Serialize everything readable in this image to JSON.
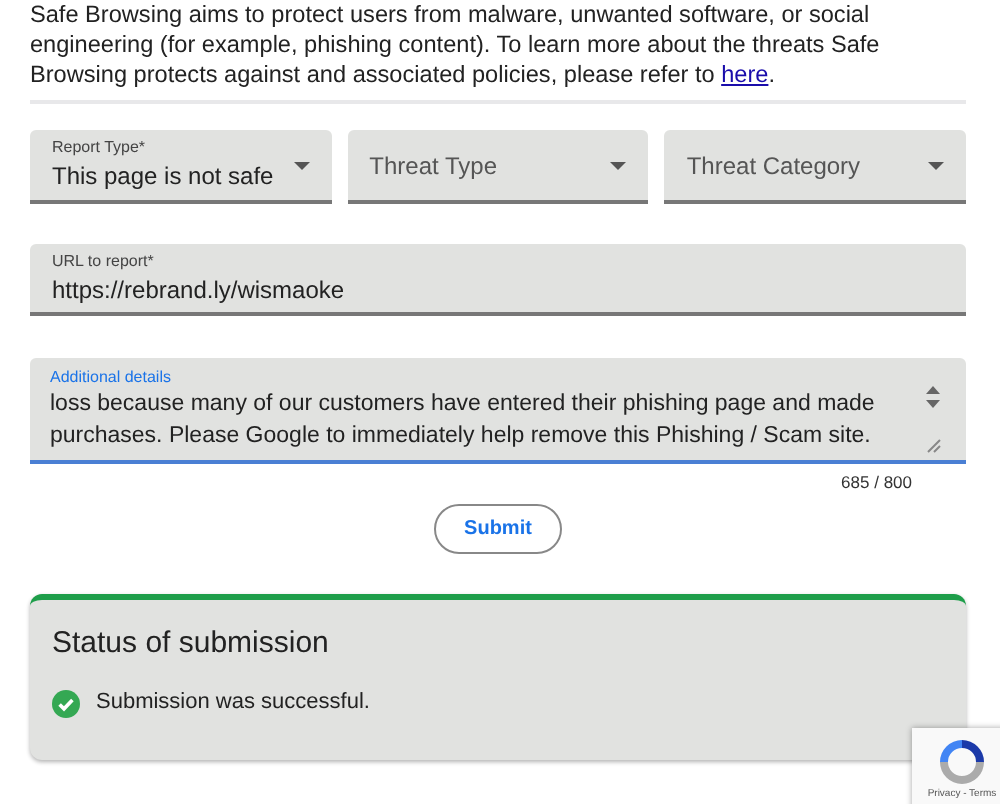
{
  "intro": {
    "text": "Safe Browsing aims to protect users from malware, unwanted software, or social engineering (for example, phishing content). To learn more about the threats Safe Browsing protects against and associated policies, please refer to ",
    "link": "here",
    "end": "."
  },
  "selects": [
    {
      "label": "Report Type*",
      "value": "This page is not safe"
    },
    {
      "placeholder": "Threat Type"
    },
    {
      "placeholder": "Threat Category"
    }
  ],
  "url_field": {
    "label": "URL to report*",
    "value": "https://rebrand.ly/wismaoke"
  },
  "details_field": {
    "label": "Additional details",
    "value": "loss because many of our customers have entered their phishing page and made purchases. Please Google to immediately help remove this Phishing / Scam site.",
    "focused": true,
    "counter": "685 / 800"
  },
  "submit": "Submit",
  "status": {
    "title": "Status of submission",
    "message": "Submission was successful."
  },
  "recaptcha": {
    "links": "Privacy - Terms"
  }
}
